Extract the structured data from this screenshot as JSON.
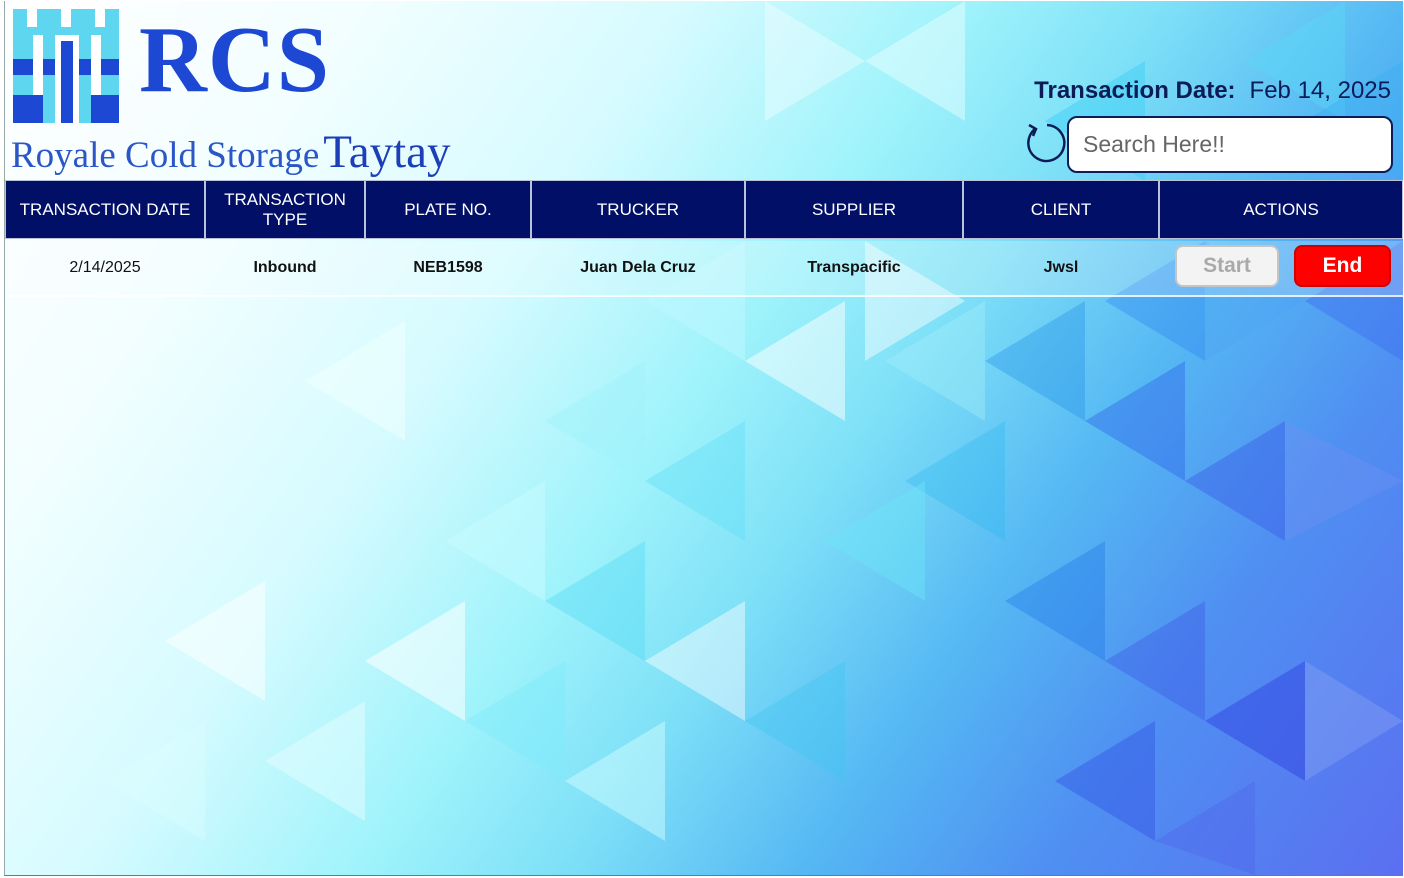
{
  "branding": {
    "logo_text": "RCS",
    "company_name": "Royale Cold Storage",
    "branch_name": "Taytay"
  },
  "header": {
    "date_label": "Transaction Date:",
    "date_value": "Feb 14, 2025"
  },
  "search": {
    "placeholder": "Search Here!!",
    "value": ""
  },
  "icons": {
    "refresh": "refresh-icon",
    "logo": "castle-logo-icon"
  },
  "colors": {
    "header_bg": "#020f66",
    "end_button": "#ff0000",
    "brand_blue": "#1c48d4"
  },
  "table": {
    "columns": [
      "TRANSACTION DATE",
      "TRANSACTION TYPE",
      "PLATE NO.",
      "TRUCKER",
      "SUPPLIER",
      "CLIENT",
      "ACTIONS"
    ],
    "rows": [
      {
        "transaction_date": "2/14/2025",
        "transaction_type": "Inbound",
        "plate_no": "NEB1598",
        "trucker": "Juan Dela Cruz",
        "supplier": "Transpacific",
        "client": "Jwsl",
        "actions": {
          "start_label": "Start",
          "end_label": "End"
        }
      }
    ]
  }
}
